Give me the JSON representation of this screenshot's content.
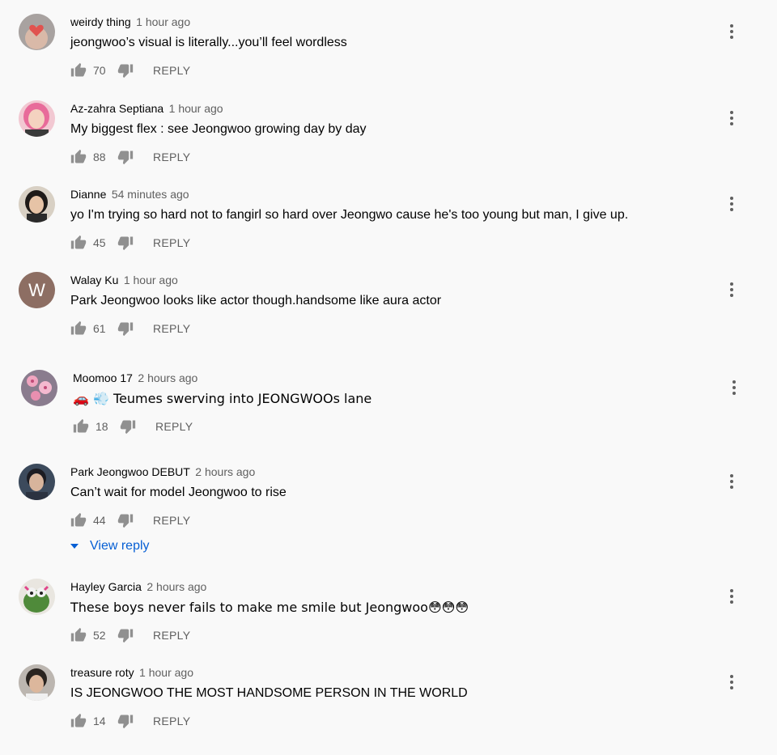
{
  "reply_label": "REPLY",
  "view_reply_label": "View reply",
  "comments": [
    {
      "author": "weirdy thing",
      "time": "1 hour ago",
      "text": "jeongwoo’s visual is literally...you’ll feel wordless",
      "likes": "70",
      "avatar": "heart-hands-photo"
    },
    {
      "author": "Az-zahra Septiana",
      "time": "1 hour ago",
      "text": "My biggest flex : see Jeongwoo growing day by day",
      "likes": "88",
      "avatar": "pink-hair-photo"
    },
    {
      "author": "Dianne",
      "time": "54 minutes ago",
      "text": "yo I'm trying so hard not to fangirl so hard over Jeongwo cause he's too young but man, I give up.",
      "likes": "45",
      "avatar": "girl-photo"
    },
    {
      "author": "Walay Ku",
      "time": "1 hour ago",
      "text": "Park Jeongwoo looks like actor though.handsome like aura actor",
      "likes": "61",
      "avatar_letter": "W",
      "avatar_color": "#8d6e63"
    },
    {
      "author": "Moomoo 17",
      "time": "2 hours ago",
      "text": "🚗 💨 Teumes swerving into JEONGWOOs lane",
      "likes": "18",
      "avatar": "flowers-photo"
    },
    {
      "author": "Park Jeongwoo DEBUT",
      "time": "2 hours ago",
      "text": "Can’t wait for model Jeongwoo to rise",
      "likes": "44",
      "avatar": "boy-photo"
    },
    {
      "author": "Hayley Garcia",
      "time": "2 hours ago",
      "text": "These boys never fails to make me smile but Jeongwoo😳😳😳",
      "likes": "52",
      "avatar": "kermit-photo"
    },
    {
      "author": "treasure roty",
      "time": "1 hour ago",
      "text": "IS JEONGWOO THE MOST HANDSOME PERSON IN THE WORLD",
      "likes": "14",
      "avatar": "man-photo"
    }
  ]
}
